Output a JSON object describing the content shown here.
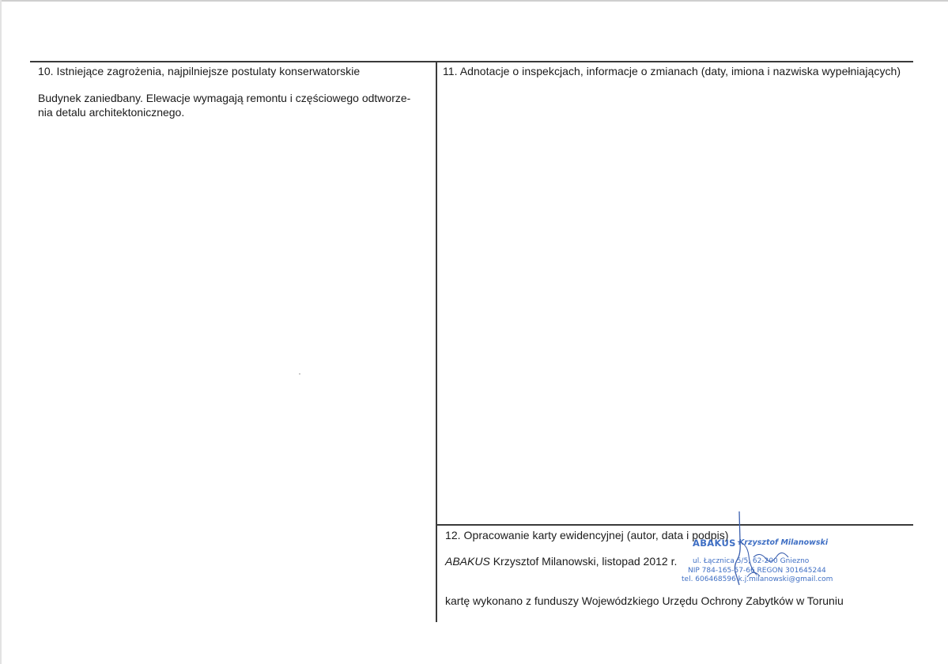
{
  "sections": {
    "s10": {
      "heading": "10. Istniejące zagrożenia, najpilniejsze postulaty konserwatorskie",
      "body_line1": "Budynek zaniedbany. Elewacje wymagają remontu i częściowego odtworze-",
      "body_line2": "nia detalu architektonicznego."
    },
    "s11": {
      "heading": "11. Adnotacje o inspekcjach, informacje o zmianach (daty, imiona i nazwiska wypełniających)"
    },
    "s12": {
      "heading": "12. Opracowanie karty ewidencyjnej (autor, data i podpis)",
      "author_company": "ABAKUS",
      "author_rest": " Krzysztof Milanowski, listopad 2012 r.",
      "funding_note": "kartę wykonano z funduszy Wojewódzkiego Urzędu Ochrony Zabytków w Toruniu"
    }
  },
  "stamp": {
    "company": "ABAKUS",
    "name": "Krzysztof Milanowski",
    "address": "ul. Łącznica 5/5, 62-200 Gniezno",
    "nip_regon": "NIP 784-165-57-66  REGON 301645244",
    "contact": "tel. 606468596  k.j.milanowski@gmail.com",
    "color": "#3f6fc4"
  }
}
